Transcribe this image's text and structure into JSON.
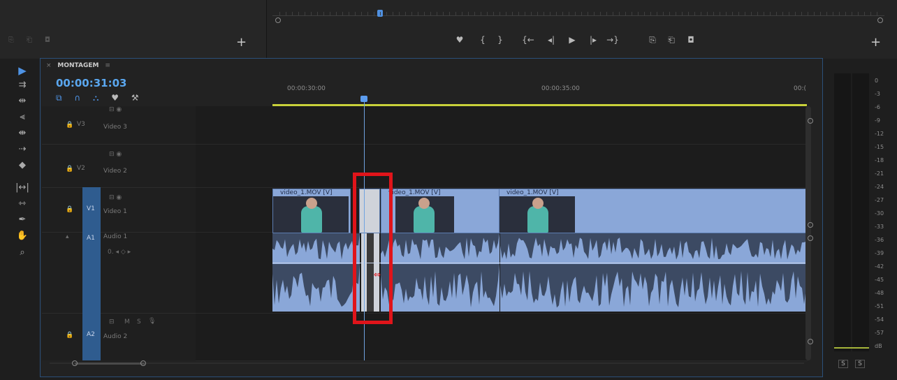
{
  "monitor": {
    "add_label": "+",
    "transport": [
      "♥",
      "{",
      "}",
      "{←",
      "◂|",
      "▶",
      "|▸",
      "→}",
      "⎘",
      "⎗",
      "◘"
    ],
    "transport_names": [
      "add-marker-button",
      "mark-in-button",
      "mark-out-button",
      "go-to-in-button",
      "step-back-button",
      "play-button",
      "step-forward-button",
      "go-to-out-button",
      "insert-button",
      "overwrite-button",
      "export-frame-button"
    ]
  },
  "sequence": {
    "name": "MONTAGEM",
    "menu_icon": "≡",
    "timecode": "00:00:31:03",
    "ruler_labels": [
      "00:00:30:00",
      "00:00:35:00",
      "00:("
    ]
  },
  "tracks": {
    "v3": {
      "id": "V3",
      "name": "Video 3"
    },
    "v2": {
      "id": "V2",
      "name": "Video 2"
    },
    "v1": {
      "id": "V1",
      "name": "Video 1"
    },
    "a1": {
      "id": "A1",
      "name": "Audio 1",
      "controls": "0.  ◂ ◇ ▸"
    },
    "a2": {
      "id": "A2",
      "name": "Audio 2",
      "m": "M",
      "s": "S"
    }
  },
  "clips": {
    "c1": "video_1.MOV [V]",
    "c2": "video_1.MOV [V]",
    "c3": "video_1.MOV [V]"
  },
  "meter": {
    "db_labels": [
      "0",
      "-3",
      "-6",
      "-9",
      "-12",
      "-15",
      "-18",
      "-21",
      "-24",
      "-27",
      "-30",
      "-33",
      "-36",
      "-39",
      "-42",
      "-45",
      "-48",
      "-51",
      "-54",
      "-57",
      "dB"
    ],
    "solo_left": "S",
    "solo_right": "S"
  },
  "colors": {
    "accent": "#5aa7ef",
    "clip": "#8aa7d8",
    "highlight": "#e0141a",
    "work_area": "#c9d13a"
  }
}
